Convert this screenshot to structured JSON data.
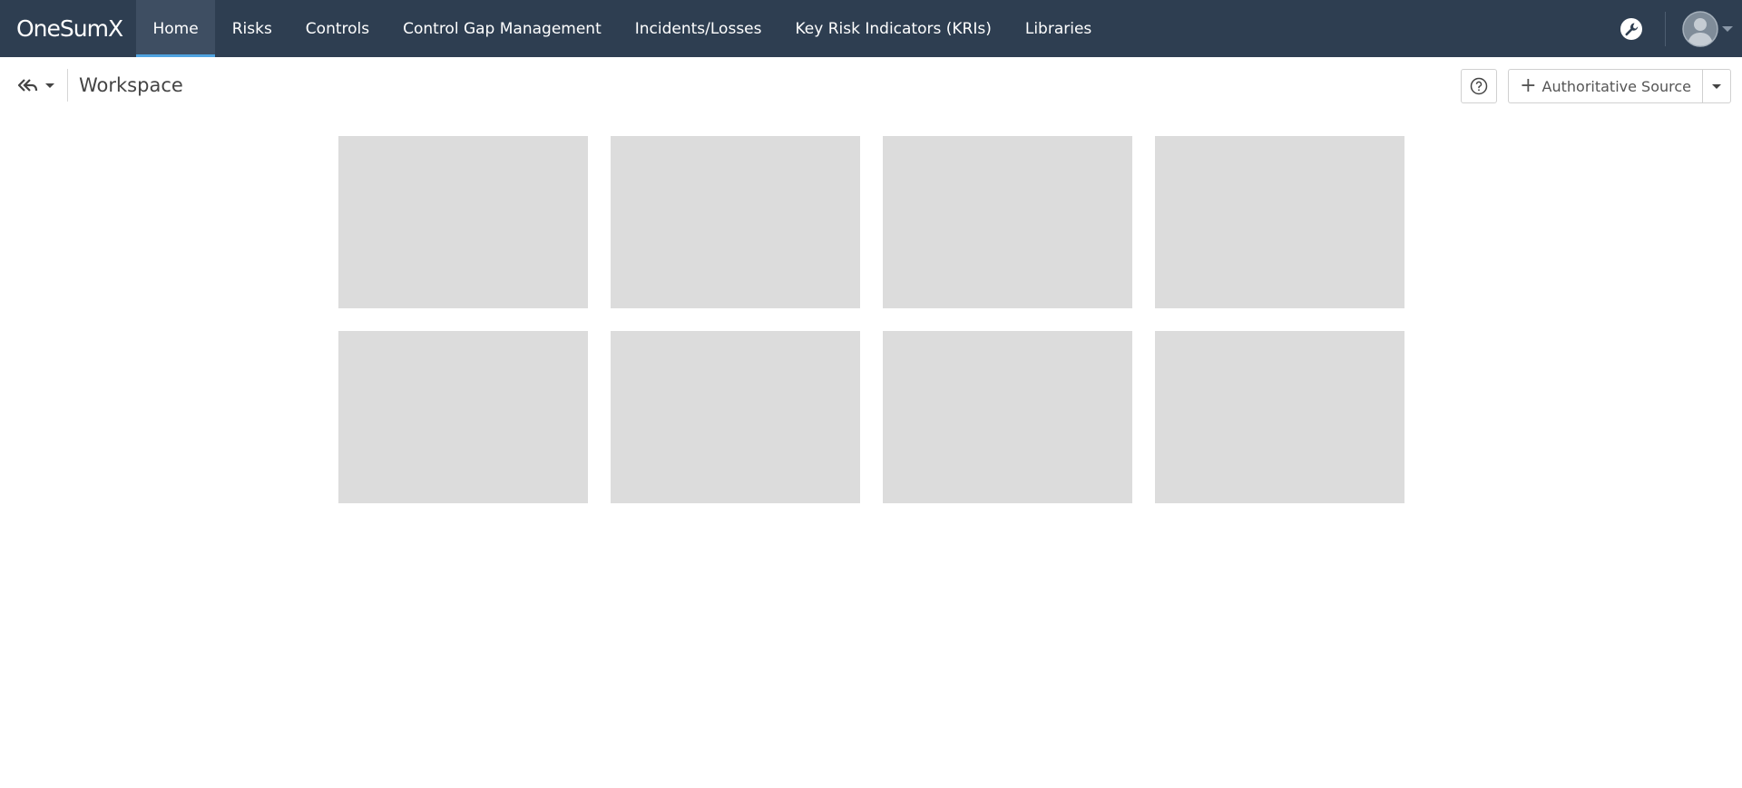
{
  "app": {
    "logo_text": "OneSumX"
  },
  "nav": {
    "items": [
      {
        "label": "Home",
        "active": true
      },
      {
        "label": "Risks"
      },
      {
        "label": "Controls"
      },
      {
        "label": "Control Gap Management"
      },
      {
        "label": "Incidents/Losses"
      },
      {
        "label": "Key Risk Indicators (KRIs)"
      },
      {
        "label": "Libraries"
      }
    ]
  },
  "header_icons": {
    "admin": "wrench-icon",
    "user": "user-avatar-icon"
  },
  "workspace": {
    "title": "Workspace",
    "back_icon": "reply-all-icon",
    "help_icon": "question-circle-icon",
    "add_button_label": "Authoritative Source",
    "add_icon": "plus-icon"
  },
  "tiles_count_note": "",
  "colors": {
    "topbar": "#2e3e51",
    "nav_active": "#3e4e62",
    "nav_active_indicator": "#4fa3e0",
    "tile_placeholder": "#dcdcdc"
  }
}
